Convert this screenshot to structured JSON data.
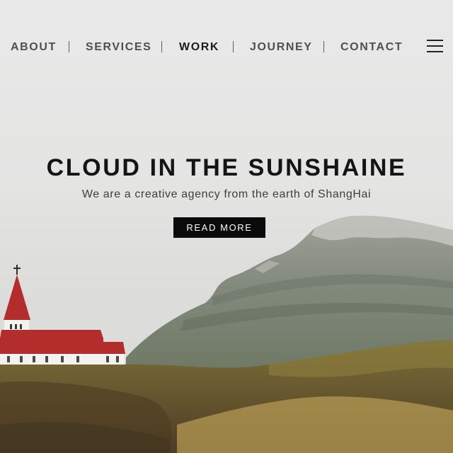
{
  "nav": {
    "items": [
      {
        "label": "ABOUT"
      },
      {
        "label": "SERVICES"
      },
      {
        "label": "WORK",
        "active": true
      },
      {
        "label": "JOURNEY"
      },
      {
        "label": "CONTACT"
      }
    ],
    "menu_icon": "hamburger-menu-icon"
  },
  "hero": {
    "title": "CLOUD IN THE SUNSHAINE",
    "subtitle": "We are a creative agency from the earth of ShangHai",
    "cta_label": "READ MORE"
  },
  "colors": {
    "sky": "#e6e6e5",
    "mountain": "#8a8f82",
    "church_roof": "#b32d2d",
    "field": "#7a6a32",
    "button_bg": "#0b0b0b",
    "text_dark": "#141414"
  }
}
